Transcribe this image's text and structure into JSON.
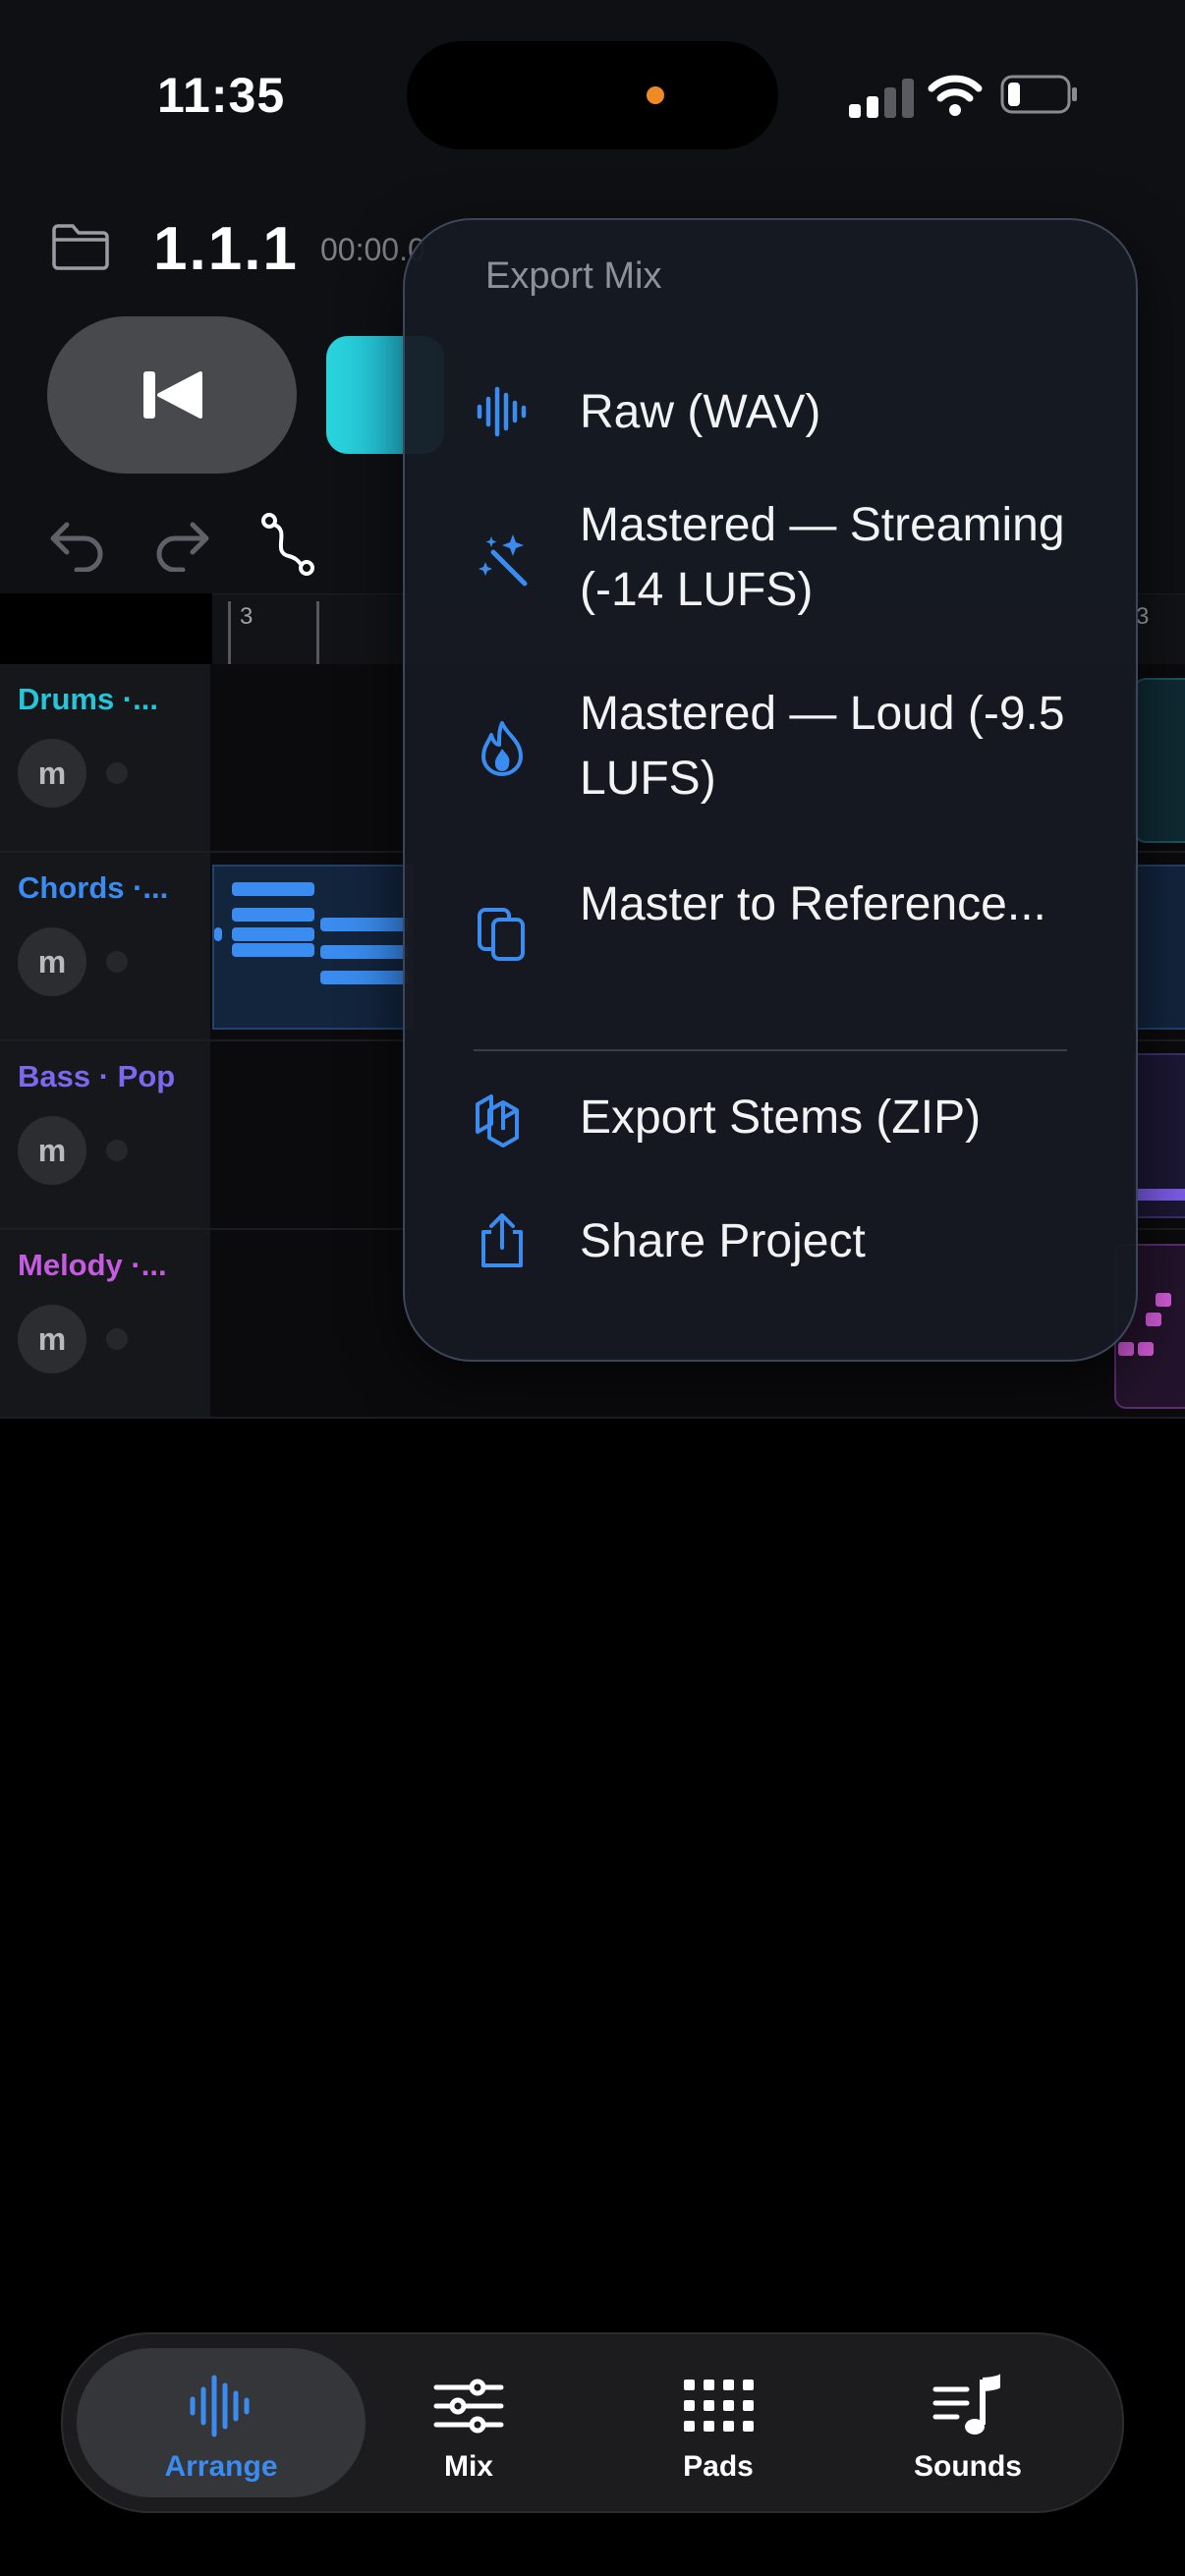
{
  "status_bar": {
    "time": "11:35"
  },
  "header": {
    "position": "1.1.1",
    "timecode": "00:00.0"
  },
  "ruler": {
    "marks": [
      "3",
      "3"
    ]
  },
  "tracks": [
    {
      "name": "Drums ·...",
      "mute_label": "m",
      "color": "#26c6da"
    },
    {
      "name": "Chords ·...",
      "mute_label": "m",
      "color": "#3a8cf0"
    },
    {
      "name": "Bass · Pop",
      "mute_label": "m",
      "color": "#7b68ee"
    },
    {
      "name": "Melody ·...",
      "mute_label": "m",
      "color": "#c55be0"
    }
  ],
  "export_menu": {
    "title": "Export Mix",
    "items": [
      {
        "label": "Raw (WAV)",
        "icon": "waveform-icon"
      },
      {
        "label": "Mastered — Streaming (-14 LUFS)",
        "icon": "magic-wand-icon"
      },
      {
        "label": "Mastered — Loud (-9.5 LUFS)",
        "icon": "flame-icon"
      },
      {
        "label": "Master to Reference...",
        "icon": "copy-documents-icon"
      },
      {
        "label": "Export Stems (ZIP)",
        "icon": "stacked-layers-icon"
      },
      {
        "label": "Share Project",
        "icon": "share-icon"
      }
    ]
  },
  "tab_bar": {
    "tabs": [
      {
        "label": "Arrange",
        "icon": "waveform-icon",
        "active": true
      },
      {
        "label": "Mix",
        "icon": "sliders-icon",
        "active": false
      },
      {
        "label": "Pads",
        "icon": "grid-icon",
        "active": false
      },
      {
        "label": "Sounds",
        "icon": "music-list-icon",
        "active": false
      }
    ]
  },
  "colors": {
    "accent": "#3a8cf0",
    "active_tab_text": "#3a8cf0",
    "play_button": "#2ad4dc"
  }
}
